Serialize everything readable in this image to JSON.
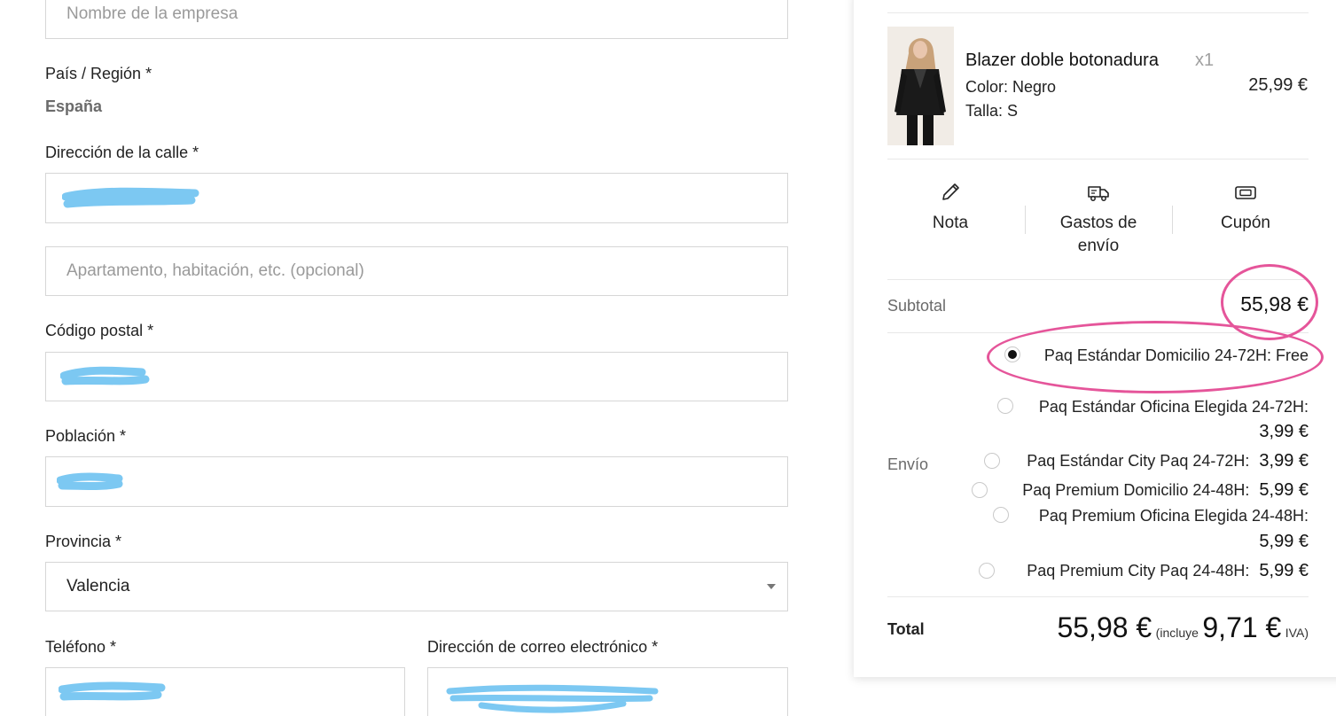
{
  "form": {
    "company": {
      "placeholder": "Nombre de la empresa"
    },
    "country": {
      "label": "País / Región *",
      "value": "España"
    },
    "street": {
      "label": "Dirección de la calle *"
    },
    "apartment": {
      "placeholder": "Apartamento, habitación, etc. (opcional)"
    },
    "postcode": {
      "label": "Código postal *"
    },
    "city": {
      "label": "Población *"
    },
    "province": {
      "label": "Provincia *",
      "value": "Valencia"
    },
    "phone": {
      "label": "Teléfono *"
    },
    "email": {
      "label": "Dirección de correo electrónico *"
    }
  },
  "cart": {
    "product": {
      "name": "Blazer doble botonadura",
      "qty": "x1",
      "color_key": "Color:",
      "color_val": "Negro",
      "size_key": "Talla:",
      "size_val": "S",
      "price": "25,99 €"
    },
    "tools": [
      {
        "label": "Nota",
        "icon": "pencil-icon"
      },
      {
        "label_line1": "Gastos de",
        "label_line2": "envío",
        "icon": "truck-icon"
      },
      {
        "label": "Cupón",
        "icon": "ticket-icon"
      }
    ],
    "subtotal": {
      "label": "Subtotal",
      "value": "55,98 €"
    },
    "shipping": {
      "label": "Envío",
      "options": [
        {
          "text": "Paq Estándar Domicilio 24-72H: Free",
          "selected": true
        },
        {
          "text": "Paq Estándar Oficina Elegida 24-72H:",
          "price": "3,99 €"
        },
        {
          "text": "Paq Estándar City Paq 24-72H:",
          "price": "3,99 €"
        },
        {
          "text": "Paq Premium Domicilio 24-48H:",
          "price": "5,99 €"
        },
        {
          "text": "Paq Premium Oficina Elegida 24-48H:",
          "price": "5,99 €"
        },
        {
          "text": "Paq Premium City Paq 24-48H:",
          "price": "5,99 €"
        }
      ]
    },
    "total": {
      "label": "Total",
      "value": "55,98 €",
      "incl_pre": "(incluye",
      "tax": "9,71 €",
      "tax_suffix": "IVA)"
    }
  },
  "colors": {
    "highlight_ring": "#e5559a",
    "redaction": "#7cc8f2"
  }
}
